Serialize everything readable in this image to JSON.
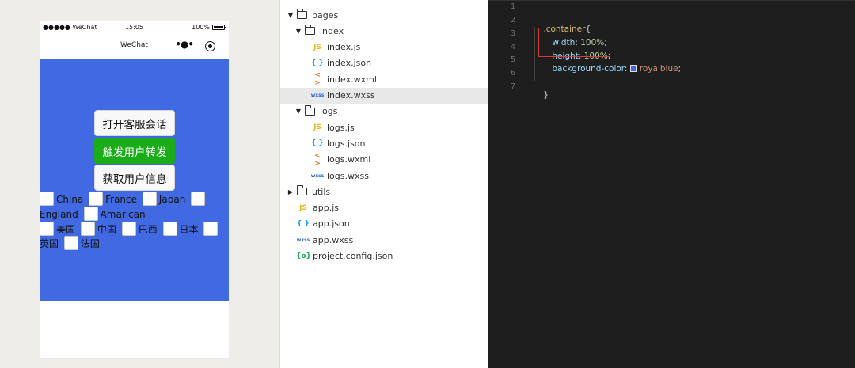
{
  "simulator": {
    "status_left": "●●●●● WeChat",
    "status_time": "15:05",
    "status_battery": "100%",
    "nav_title": "WeChat",
    "menu_dots": "•●•",
    "buttons": {
      "contact": "打开客服会话",
      "share": "触发用户转发",
      "userinfo": "获取用户信息"
    },
    "checkboxes_en": [
      "China",
      "France",
      "Japan",
      "England",
      "Amarican"
    ],
    "checkboxes_cn": [
      "美国",
      "中国",
      "巴西",
      "日本",
      "英国",
      "法国"
    ],
    "background_color": "#4169e1",
    "share_button_color": "#1aad19"
  },
  "file_tree": [
    {
      "name": "pages",
      "type": "folder",
      "state": "expanded",
      "icon": "folder-open-icon"
    },
    {
      "name": "index",
      "type": "folder",
      "state": "expanded",
      "icon": "folder-open-icon"
    },
    {
      "name": "index.js",
      "type": "js",
      "icon_text": "JS"
    },
    {
      "name": "index.json",
      "type": "json",
      "icon_text": "{ }"
    },
    {
      "name": "index.wxml",
      "type": "wxml",
      "icon_text": "< >"
    },
    {
      "name": "index.wxss",
      "type": "wxss",
      "icon_text": "wxss",
      "selected": true
    },
    {
      "name": "logs",
      "type": "folder",
      "state": "expanded",
      "icon": "folder-open-icon"
    },
    {
      "name": "logs.js",
      "type": "js",
      "icon_text": "JS"
    },
    {
      "name": "logs.json",
      "type": "json",
      "icon_text": "{ }"
    },
    {
      "name": "logs.wxml",
      "type": "wxml",
      "icon_text": "< >"
    },
    {
      "name": "logs.wxss",
      "type": "wxss",
      "icon_text": "wxss"
    },
    {
      "name": "utils",
      "type": "folder",
      "state": "collapsed",
      "icon": "folder-icon"
    },
    {
      "name": "app.js",
      "type": "js",
      "icon_text": "JS"
    },
    {
      "name": "app.json",
      "type": "json",
      "icon_text": "{ }"
    },
    {
      "name": "app.wxss",
      "type": "wxss",
      "icon_text": "wxss"
    },
    {
      "name": "project.config.json",
      "type": "config",
      "icon_text": "{o}"
    }
  ],
  "editor": {
    "line_numbers": [
      "1",
      "2",
      "3",
      "4",
      "5",
      "6",
      "7"
    ],
    "lines": {
      "selector": ".container",
      "open_brace": "{",
      "width_prop": "width",
      "width_val": "100%",
      "height_prop": "height",
      "height_val": "100%",
      "bg_prop": "background-color",
      "bg_val": "royalblue",
      "colon": ":",
      "semicolon": ";",
      "close_brace": "}"
    },
    "swatch_color": "#4169e1",
    "highlight_color": "#d93a3a"
  }
}
